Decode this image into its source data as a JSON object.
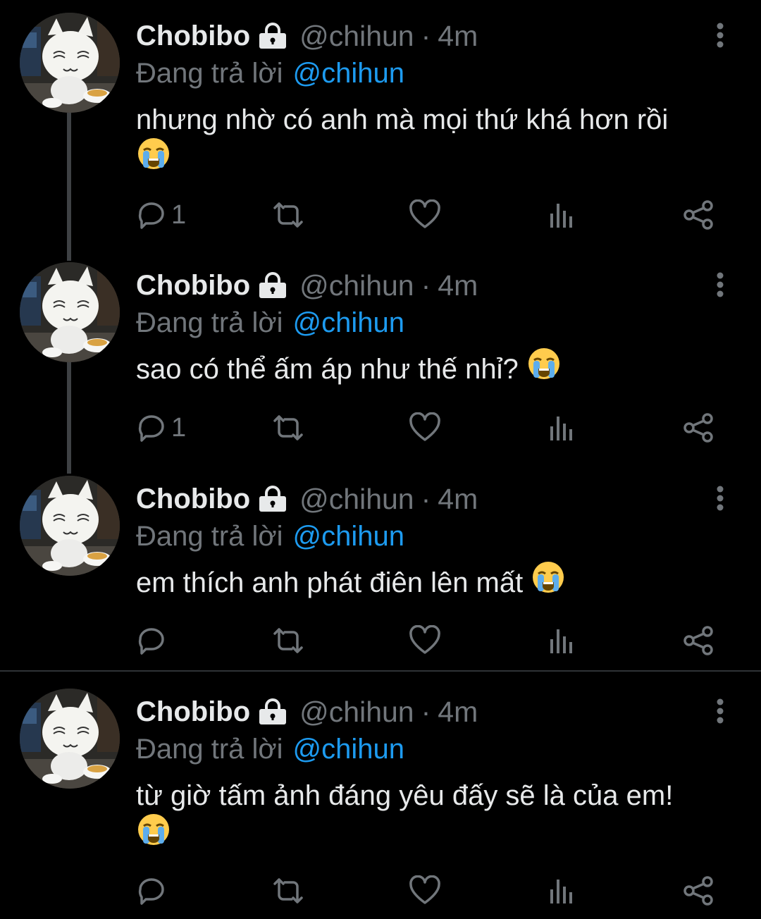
{
  "colors": {
    "background": "#000000",
    "text_primary": "#e7e9ea",
    "text_secondary": "#71767b",
    "accent": "#1d9bf0",
    "thread_line": "#3e4144"
  },
  "tweets": [
    {
      "name": "Chobibo",
      "lock_icon": "lock-icon",
      "handle": "@chihun",
      "separator": "·",
      "time": "4m",
      "reply_prefix": "Đang trả lời",
      "reply_handle": "@chihun",
      "text": "nhưng nhờ có anh mà mọi thứ khá hơn rồi",
      "emoji": "loudly-crying-face",
      "reply_count": "1"
    },
    {
      "name": "Chobibo",
      "lock_icon": "lock-icon",
      "handle": "@chihun",
      "separator": "·",
      "time": "4m",
      "reply_prefix": "Đang trả lời",
      "reply_handle": "@chihun",
      "text": "sao có thể ấm áp như thế nhỉ?",
      "emoji": "loudly-crying-face",
      "reply_count": "1"
    },
    {
      "name": "Chobibo",
      "lock_icon": "lock-icon",
      "handle": "@chihun",
      "separator": "·",
      "time": "4m",
      "reply_prefix": "Đang trả lời",
      "reply_handle": "@chihun",
      "text": "em thích anh phát điên lên mất",
      "emoji": "loudly-crying-face",
      "reply_count": ""
    },
    {
      "name": "Chobibo",
      "lock_icon": "lock-icon",
      "handle": "@chihun",
      "separator": "·",
      "time": "4m",
      "reply_prefix": "Đang trả lời",
      "reply_handle": "@chihun",
      "text": "từ giờ tấm ảnh đáng yêu đấy sẽ là của em!",
      "emoji": "loudly-crying-face",
      "reply_count": ""
    }
  ],
  "action_icons": [
    "reply-icon",
    "retweet-icon",
    "like-icon",
    "views-icon",
    "share-icon"
  ]
}
